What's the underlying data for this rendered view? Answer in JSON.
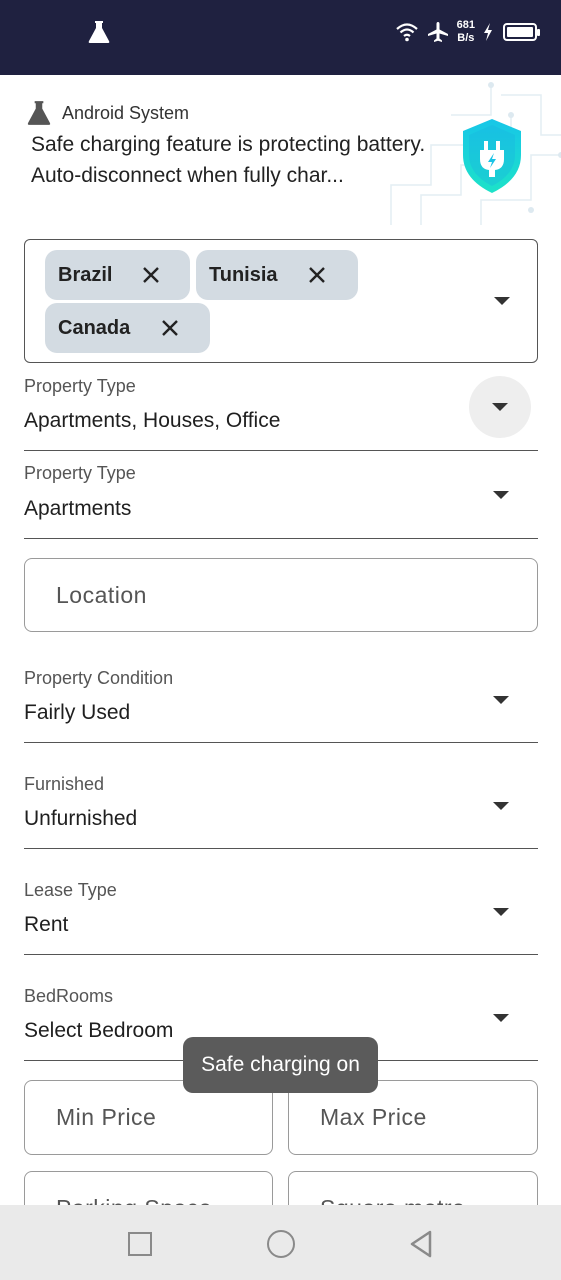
{
  "status_bar": {
    "net_speed_value": "681",
    "net_speed_unit": "B/s",
    "icons": [
      "flask-icon",
      "wifi-icon",
      "airplane-icon",
      "charging-bolt-icon",
      "battery-icon"
    ]
  },
  "notification": {
    "app_name": "Android System",
    "text": "Safe charging feature is protecting battery. Auto-disconnect when fully char...",
    "icon": "shield-plug-icon"
  },
  "countries": {
    "chips": [
      {
        "label": "Brazil"
      },
      {
        "label": "Tunisia"
      },
      {
        "label": "Canada"
      }
    ]
  },
  "fields": {
    "property_type_multi": {
      "label": "Property Type",
      "value": "Apartments, Houses, Office"
    },
    "property_type": {
      "label": "Property Type",
      "value": "Apartments"
    },
    "location": {
      "placeholder": "Location"
    },
    "property_condition": {
      "label": "Property Condition",
      "value": "Fairly Used"
    },
    "furnished": {
      "label": "Furnished",
      "value": "Unfurnished"
    },
    "lease_type": {
      "label": "Lease Type",
      "value": "Rent"
    },
    "bedrooms": {
      "label": "BedRooms",
      "value": "Select Bedroom"
    },
    "min_price": {
      "placeholder": "Min Price"
    },
    "max_price": {
      "placeholder": "Max Price"
    },
    "parking_space": {
      "placeholder": "Parking Space"
    },
    "square_metre": {
      "placeholder": "Square metre"
    }
  },
  "toast": {
    "text": "Safe charging on"
  },
  "colors": {
    "status_bar_bg": "#1f2140",
    "chip_bg": "#d3dbe2",
    "toast_bg": "#5b5b5b",
    "shield_accent": "#17c6e8"
  }
}
